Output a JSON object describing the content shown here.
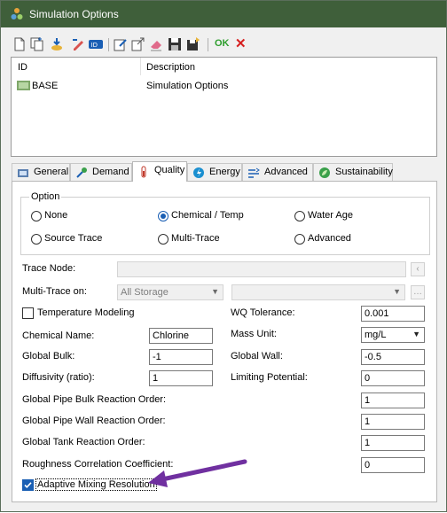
{
  "window": {
    "title": "Simulation Options"
  },
  "toolbar": {
    "ok_label": "OK",
    "cancel_symbol": "✕"
  },
  "list": {
    "headers": {
      "id": "ID",
      "description": "Description"
    },
    "rows": [
      {
        "id": "BASE",
        "description": "Simulation Options"
      }
    ]
  },
  "tabs": [
    {
      "label": "General",
      "icon": "general-icon",
      "active": false
    },
    {
      "label": "Demand",
      "icon": "demand-icon",
      "active": false
    },
    {
      "label": "Quality",
      "icon": "quality-icon",
      "active": true
    },
    {
      "label": "Energy",
      "icon": "energy-icon",
      "active": false
    },
    {
      "label": "Advanced",
      "icon": "advanced-icon",
      "active": false
    },
    {
      "label": "Sustainability",
      "icon": "sustainability-icon",
      "active": false
    }
  ],
  "quality": {
    "option_group_label": "Option",
    "options": [
      {
        "label": "None",
        "selected": false
      },
      {
        "label": "Chemical / Temp",
        "selected": true
      },
      {
        "label": "Water Age",
        "selected": false
      },
      {
        "label": "Source Trace",
        "selected": false
      },
      {
        "label": "Multi-Trace",
        "selected": false
      },
      {
        "label": "Advanced",
        "selected": false
      }
    ],
    "trace_node": {
      "label": "Trace Node:",
      "value": ""
    },
    "multi_trace": {
      "label": "Multi-Trace on:",
      "value": "All Storage",
      "second_value": ""
    },
    "temperature_modeling": {
      "label": "Temperature Modeling",
      "checked": false
    },
    "wq_tolerance": {
      "label": "WQ Tolerance:",
      "value": "0.001"
    },
    "chemical_name": {
      "label": "Chemical Name:",
      "value": "Chlorine"
    },
    "mass_unit": {
      "label": "Mass Unit:",
      "value": "mg/L"
    },
    "global_bulk": {
      "label": "Global Bulk:",
      "value": "-1"
    },
    "global_wall": {
      "label": "Global Wall:",
      "value": "-0.5"
    },
    "diffusivity": {
      "label": "Diffusivity (ratio):",
      "value": "1"
    },
    "limiting_potential": {
      "label": "Limiting Potential:",
      "value": "0"
    },
    "pipe_bulk_order": {
      "label": "Global Pipe Bulk Reaction Order:",
      "value": "1"
    },
    "pipe_wall_order": {
      "label": "Global Pipe Wall Reaction Order:",
      "value": "1"
    },
    "tank_order": {
      "label": "Global Tank Reaction Order:",
      "value": "1"
    },
    "roughness_coefficient": {
      "label": "Roughness Correlation Coefficient:",
      "value": "0"
    },
    "adaptive_mixing": {
      "label": "Adaptive Mixing Resolution",
      "checked": true
    }
  },
  "colors": {
    "titlebar": "#3f5f3a",
    "accent": "#1a5fb4",
    "annotation_arrow": "#7030a0"
  }
}
